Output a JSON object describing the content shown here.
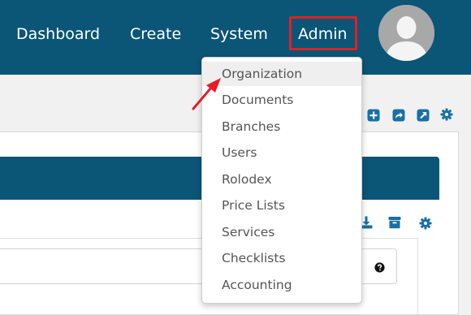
{
  "nav": {
    "dashboard": "Dashboard",
    "create": "Create",
    "system": "System",
    "admin": "Admin"
  },
  "admin_menu": [
    "Organization",
    "Documents",
    "Branches",
    "Users",
    "Rolodex",
    "Price Lists",
    "Services",
    "Checklists",
    "Accounting"
  ],
  "icons": {
    "toolbar": [
      "plus-square-icon",
      "share-square-icon",
      "external-link-square-icon",
      "gear-icon"
    ],
    "panel": [
      "download-icon",
      "archive-icon",
      "gear-icon"
    ],
    "field": "question-circle-icon"
  },
  "colors": {
    "header": "#0b5577",
    "accent_icon": "#1670a6",
    "highlight": "#e41e26"
  }
}
